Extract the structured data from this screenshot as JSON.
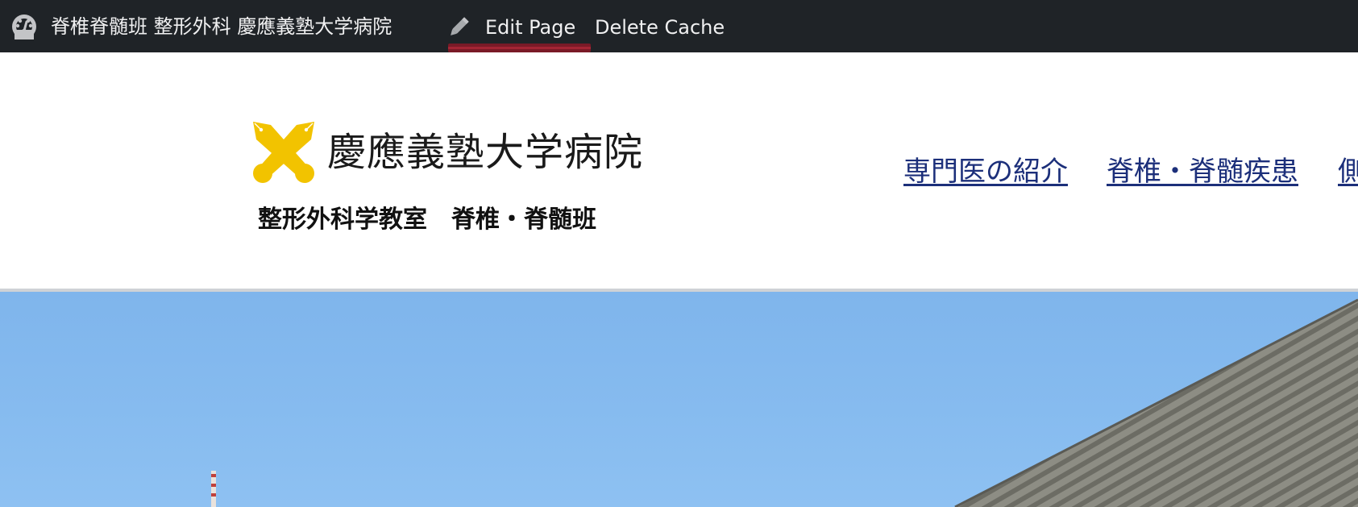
{
  "adminbar": {
    "dashboard_icon": "dashboard-gauge-icon",
    "site_name": "脊椎脊髄班 整形外科 慶應義塾大学病院",
    "edit_icon": "pencil-icon",
    "edit_label": "Edit Page",
    "delete_cache_label": "Delete Cache",
    "background_color": "#1f2327",
    "highlight_color": "#7a1a27"
  },
  "header": {
    "logo_icon": "crossed-pens-logo-icon",
    "logo_color": "#f2c300",
    "hospital_name": "慶應義塾大学病院",
    "department": "整形外科学教室　脊椎・脊髄班"
  },
  "nav": {
    "items": [
      {
        "label": "専門医の紹介"
      },
      {
        "label": "脊椎・脊髄疾患"
      },
      {
        "label": "側"
      }
    ],
    "link_color": "#1c2f7a"
  },
  "hero": {
    "image": "hospital-building-photo",
    "sky_color": "#86bbef"
  }
}
